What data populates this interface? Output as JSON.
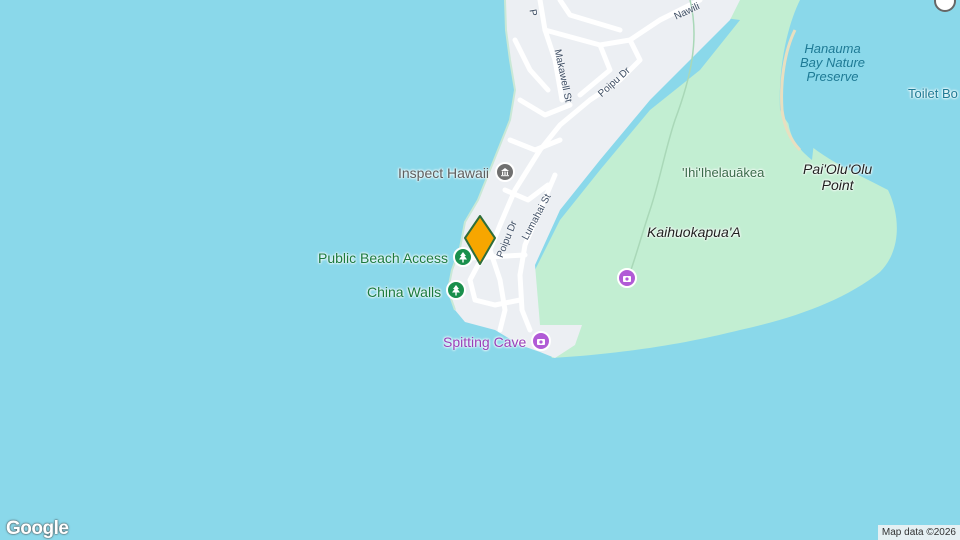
{
  "map": {
    "poi": {
      "inspect_hawaii": "Inspect Hawaii",
      "public_beach_access": "Public Beach Access",
      "china_walls": "China Walls",
      "spitting_cave": "Spitting Cave",
      "toilet_partial": "Toilet Bo"
    },
    "areas": {
      "hanauma_line1": "Hanauma",
      "hanauma_line2": "Bay Nature",
      "hanauma_line3": "Preserve",
      "ihi": "'Ihi'Ihelauākea",
      "paiolu_line1": "Pai'Olu'Olu",
      "paiolu_line2": "Point",
      "kaihuokapua": "Kaihuokapua'A"
    },
    "streets": {
      "poipu_dr_a": "Poipu Dr",
      "poipu_dr_b": "Poipu Dr",
      "makawell": "Makawell St",
      "lumahai": "Lumahai St",
      "nawili_partial": "Nawili",
      "p_partial": "P"
    },
    "attribution": "Map data ©2026",
    "logo": "Google",
    "colors": {
      "water": "#8ad8ea",
      "park": "#c2eed2",
      "urban": "#eceff3",
      "road": "#ffffff",
      "marker_fill": "#f7a600",
      "marker_stroke": "#2f6e3b",
      "poi_green": "#1a8f4c",
      "poi_purple": "#b15bd6",
      "poi_gray": "#707070"
    }
  }
}
